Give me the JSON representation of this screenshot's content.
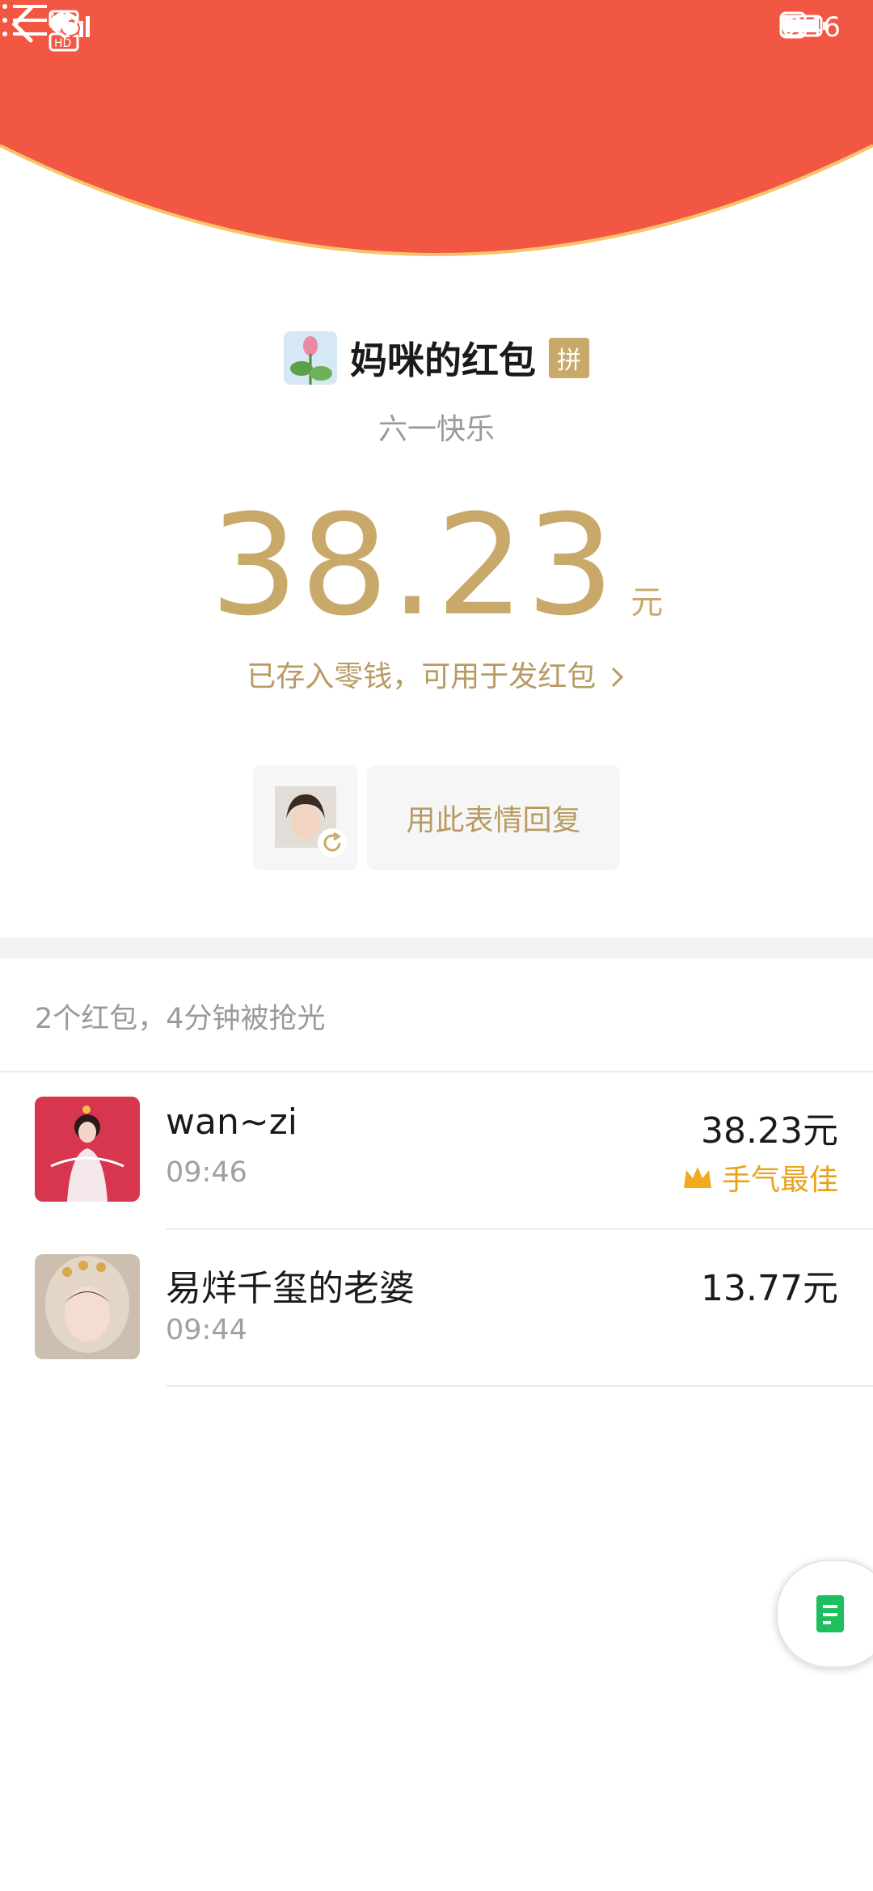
{
  "status_bar": {
    "time": "9:46",
    "network": "4G"
  },
  "nav": {
    "back_icon": "chevron-left-icon",
    "menu_icon": "list-menu-icon"
  },
  "colors": {
    "header_red": "#f25743",
    "gold": "#c9a96a",
    "gold_text": "#b89a63",
    "best_orange": "#e8a21b"
  },
  "sender": {
    "name": "妈咪的红包",
    "badge": "拼",
    "wish": "六一快乐"
  },
  "amount": {
    "value": "38.23",
    "unit": "元",
    "saved_text": "已存入零钱，可用于发红包"
  },
  "reply": {
    "label": "用此表情回复"
  },
  "summary": {
    "text": "2个红包，4分钟被抢光"
  },
  "records": [
    {
      "name": "wan~zi",
      "time": "09:46",
      "amount": "38.23元",
      "tag": "手气最佳"
    },
    {
      "name": "易烊千玺的老婆",
      "time": "09:44",
      "amount": "13.77元"
    }
  ]
}
